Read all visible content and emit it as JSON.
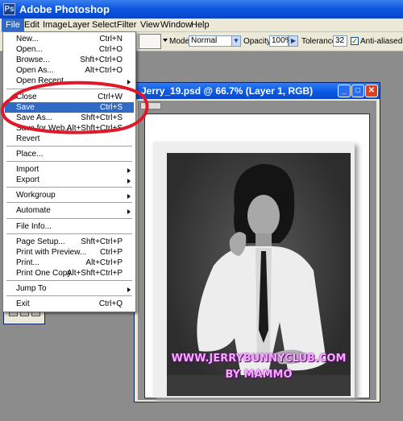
{
  "app": {
    "title": "Adobe Photoshop",
    "icon": "photoshop-app-icon"
  },
  "menubar": {
    "items": [
      "File",
      "Edit",
      "Image",
      "Layer",
      "Select",
      "Filter",
      "View",
      "Window",
      "Help"
    ],
    "active": "File"
  },
  "options": {
    "mode_label": "Mode:",
    "mode_value": "Normal",
    "opacity_label": "Opacity:",
    "opacity_value": "100%",
    "tolerance_label": "Tolerance:",
    "tolerance_value": "32",
    "antialiased_label": "Anti-aliased",
    "antialiased_checked": true
  },
  "document": {
    "title": "Jerry_19.psd @ 66.7% (Layer 1, RGB)",
    "watermark_line1": "WWW.JERRYBUNNYCLUB.COM",
    "watermark_line2": "BY MAMMO"
  },
  "file_menu": {
    "items": [
      {
        "label": "New...",
        "shortcut": "Ctrl+N"
      },
      {
        "label": "Open...",
        "shortcut": "Ctrl+O"
      },
      {
        "label": "Browse...",
        "shortcut": "Shft+Ctrl+O"
      },
      {
        "label": "Open As...",
        "shortcut": "Alt+Ctrl+O"
      },
      {
        "label": "Open Recent",
        "submenu": true
      },
      {
        "label": "Close",
        "shortcut": "Ctrl+W"
      },
      {
        "label": "Save",
        "shortcut": "Ctrl+S",
        "highlighted": true
      },
      {
        "label": "Save As...",
        "shortcut": "Shft+Ctrl+S"
      },
      {
        "label": "Save for Web...",
        "shortcut": "Alt+Shft+Ctrl+S"
      },
      {
        "label": "Revert"
      },
      {
        "label": "Place..."
      },
      {
        "label": "Import",
        "submenu": true
      },
      {
        "label": "Export",
        "submenu": true
      },
      {
        "label": "Workgroup",
        "submenu": true
      },
      {
        "label": "Automate",
        "submenu": true
      },
      {
        "label": "File Info..."
      },
      {
        "label": "Page Setup...",
        "shortcut": "Shft+Ctrl+P"
      },
      {
        "label": "Print with Preview...",
        "shortcut": "Ctrl+P"
      },
      {
        "label": "Print...",
        "shortcut": "Alt+Ctrl+P"
      },
      {
        "label": "Print One Copy",
        "shortcut": "Alt+Shft+Ctrl+P"
      },
      {
        "label": "Jump To",
        "submenu": true
      },
      {
        "label": "Exit",
        "shortcut": "Ctrl+Q"
      }
    ]
  },
  "colors": {
    "annotation": "#e0192a",
    "highlight": "#316ac5",
    "title_bar": "#0a55df"
  }
}
